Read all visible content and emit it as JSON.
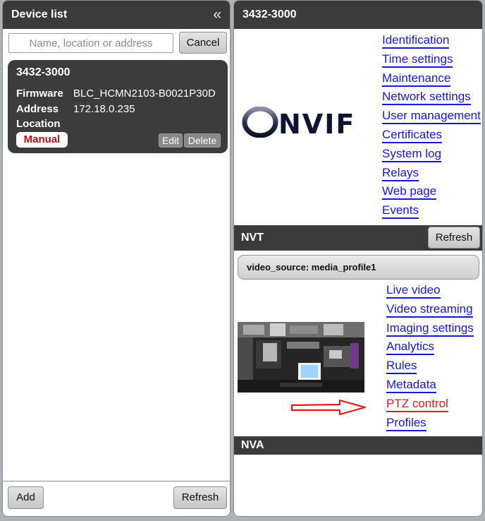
{
  "left_panel": {
    "title": "Device list",
    "collapse_icon": "double-chevron-left-icon",
    "search": {
      "placeholder": "Name, location or address",
      "value": ""
    },
    "cancel_label": "Cancel",
    "device": {
      "name": "3432-3000",
      "firmware_label": "Firmware",
      "firmware_value": "BLC_HCMN2103-B0021P30D",
      "address_label": "Address",
      "address_value": "172.18.0.235",
      "location_label": "Location",
      "location_value": "",
      "badge": "Manual",
      "edit_label": "Edit",
      "delete_label": "Delete"
    },
    "add_label": "Add",
    "refresh_label": "Refresh"
  },
  "right_panel": {
    "title": "3432-3000",
    "logo_text": "ONVIF",
    "links": [
      "Identification",
      "Time settings",
      "Maintenance",
      "Network settings",
      "User management",
      "Certificates",
      "System log",
      "Relays",
      "Web page",
      "Events"
    ],
    "nvt": {
      "title": "NVT",
      "refresh_label": "Refresh",
      "profile": "video_source: media_profile1",
      "links": [
        "Live video",
        "Video streaming",
        "Imaging settings",
        "Analytics",
        "Rules",
        "Metadata",
        "PTZ control",
        "Profiles"
      ],
      "highlighted_link": "PTZ control",
      "annotation_icon": "red-outline-arrow-right-icon"
    },
    "nva": {
      "title": "NVA"
    }
  },
  "colors": {
    "header_bg": "#3b3b3b",
    "link": "#1616d6",
    "highlight": "#e41a1a",
    "badge_text": "#b01111"
  }
}
